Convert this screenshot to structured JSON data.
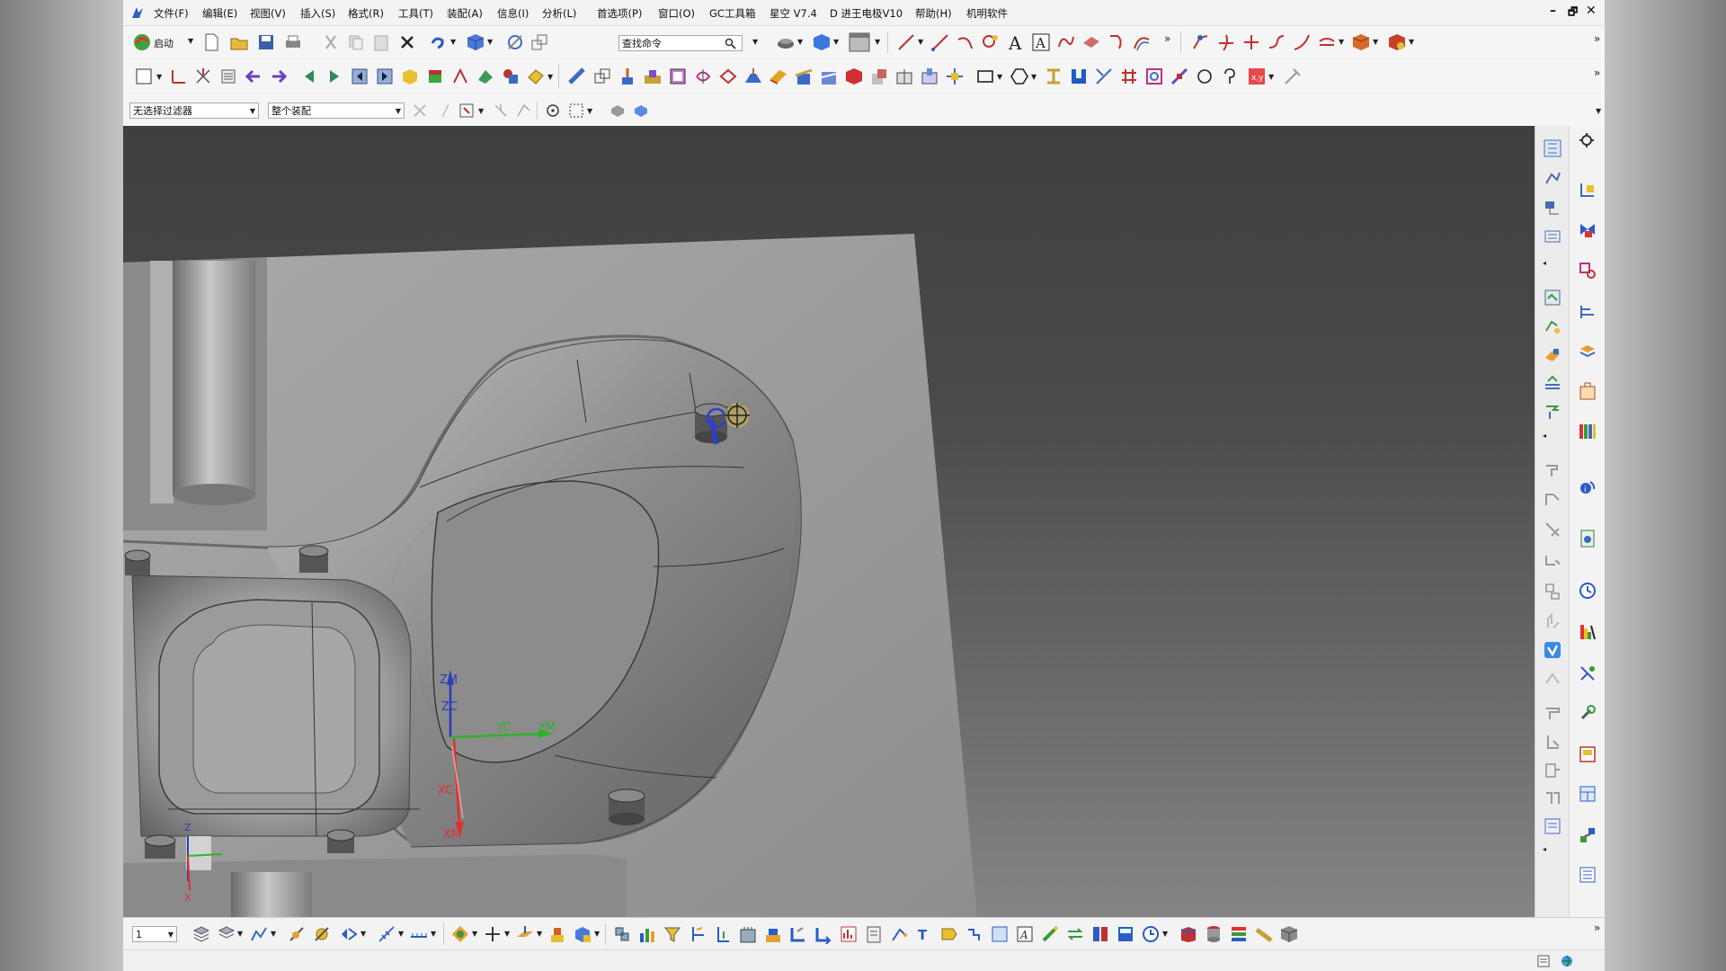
{
  "menubar": {
    "items": [
      "文件(F)",
      "编辑(E)",
      "视图(V)",
      "插入(S)",
      "格式(R)",
      "工具(T)",
      "装配(A)",
      "信息(I)",
      "分析(L)",
      "首选项(P)",
      "窗口(O)",
      "GC工具箱",
      "星空 V7.4",
      "D 进王电极V10",
      "帮助(H)",
      "机明软件"
    ]
  },
  "window_controls": {
    "minimize": "–",
    "restore": "🗗",
    "close": "✕"
  },
  "toolbar1": {
    "start_label": "启动",
    "search_placeholder": "查找命令",
    "overflow": "»"
  },
  "filterbar": {
    "selection_filter": "无选择过滤器",
    "scope": "整个装配"
  },
  "viewport": {
    "csys_labels": {
      "zm": "ZM",
      "zc": "ZC",
      "yc": "YC",
      "ym": "YM",
      "xc": "XC",
      "xm": "XM"
    },
    "mini_axis": {
      "z": "Z",
      "x": "X"
    }
  },
  "bottombar": {
    "layer_value": "1",
    "overflow": "»"
  },
  "colors": {
    "viewport_top": "#3f3f42",
    "viewport_bottom": "#858585",
    "part_gray": "#9a9a9a",
    "highlight_blue": "#2b3fd6",
    "zc_axis": "#2a3fb8",
    "yc_axis": "#2bb32b",
    "xc_axis": "#e03030"
  }
}
